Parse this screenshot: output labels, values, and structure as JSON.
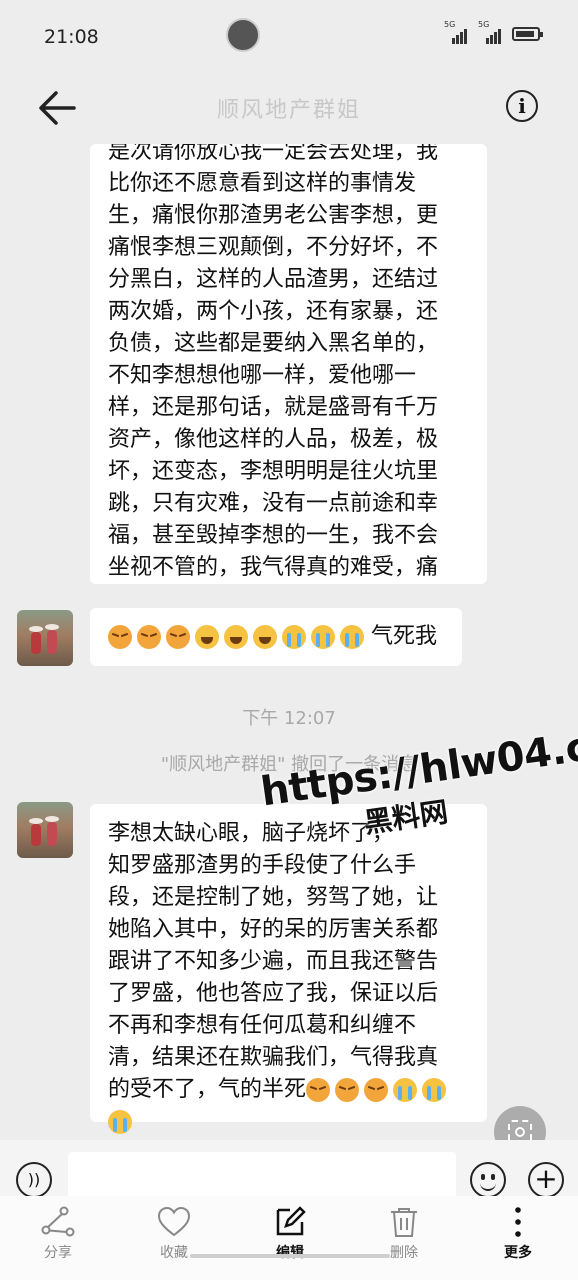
{
  "status_bar": {
    "time": "21:08",
    "signal_tags": [
      "5G",
      "5G"
    ]
  },
  "header": {
    "title": "顺风地产群姐",
    "back_icon": "arrow-left-icon",
    "info_icon": "info-icon",
    "info_glyph": "i"
  },
  "messages": [
    {
      "type": "text",
      "from": "other",
      "lines": [
        "是次请你放心我一定会去处理，我",
        "比你还不愿意看到这样的事情发",
        "生，痛恨你那渣男老公害李想，更",
        "痛恨李想三观颠倒，不分好坏，不",
        "分黑白，这样的人品渣男，还结过",
        "两次婚，两个小孩，还有家暴，还",
        "负债，这些都是要纳入黑名单的，",
        "不知李想想他哪一样，爱他哪一",
        "样，还是那句话，就是盛哥有千万",
        "资产，像他这样的人品，极差，极",
        "坏，还变态，李想明明是往火坑里",
        "跳，只有灾难，没有一点前途和幸",
        "福，甚至毁掉李想的一生，我不会",
        "坐视不管的，我气得真的难受，痛",
        "苦"
      ]
    },
    {
      "type": "emoji_text",
      "from": "other",
      "emojis": [
        "angry",
        "angry",
        "angry",
        "laugh",
        "laugh",
        "laugh",
        "cry",
        "cry",
        "cry"
      ],
      "text": "气死我"
    },
    {
      "type": "timestamp",
      "text": "下午 12:07"
    },
    {
      "type": "system",
      "text": "\"顺风地产群姐\" 撤回了一条消息"
    },
    {
      "type": "text",
      "from": "other",
      "lines": [
        "李想太缺心眼，脑子烧坏了，",
        "知罗盛那渣男的手段使了什么手",
        "段，还是控制了她，努驾了她，让",
        "她陷入其中，好的呆的厉害关系都",
        "跟讲了不知多少遍，而且我还警告",
        "了罗盛，他也答应了我，保证以后",
        "不再和李想有任何瓜葛和纠缠不",
        "清，结果还在欺骗我们，气得我真",
        "的受不了，气的半死"
      ],
      "trailing_emojis": [
        "angry",
        "angry",
        "angry",
        "cry",
        "cry",
        "cry"
      ]
    }
  ],
  "watermark": {
    "url": "https://hlw04.com",
    "text": "黑料网"
  },
  "input_bar": {
    "placeholder": "",
    "value": "",
    "plus_glyph": "+",
    "voice_glyph": "))"
  },
  "actions": [
    {
      "icon": "share-icon",
      "label": "分享"
    },
    {
      "icon": "heart-icon",
      "label": "收藏"
    },
    {
      "icon": "edit-icon",
      "label": "编辑"
    },
    {
      "icon": "trash-icon",
      "label": "删除"
    },
    {
      "icon": "more-icon",
      "label": "更多"
    }
  ]
}
